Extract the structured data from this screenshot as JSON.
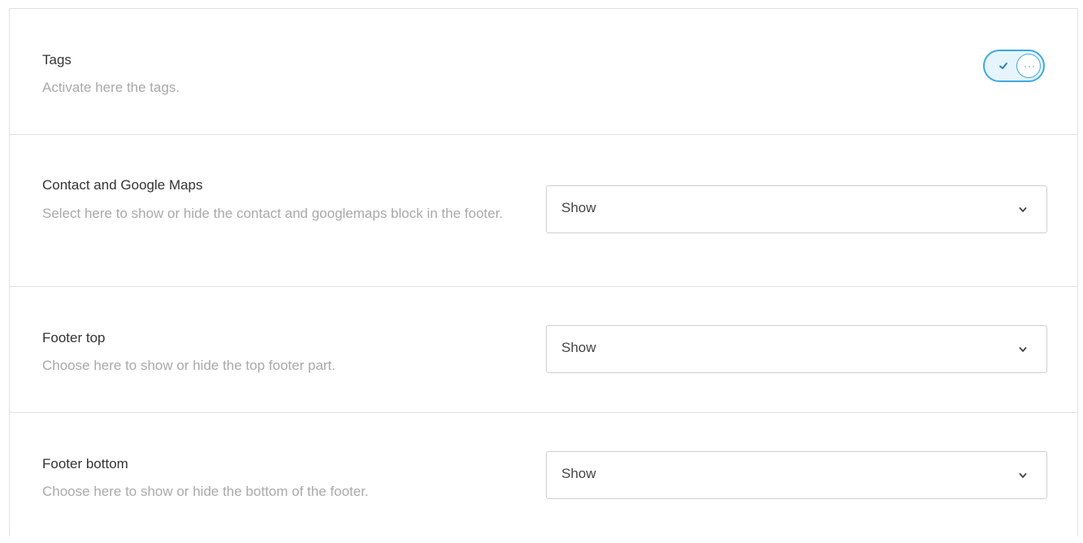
{
  "settings": {
    "tags": {
      "title": "Tags",
      "description": "Activate here the tags.",
      "enabled": true
    },
    "contact_maps": {
      "title": "Contact and Google Maps",
      "description": "Select here to show or hide the contact and googlemaps block in the footer.",
      "value": "Show"
    },
    "footer_top": {
      "title": "Footer top",
      "description": "Choose here to show or hide the top footer part.",
      "value": "Show"
    },
    "footer_bottom": {
      "title": "Footer bottom",
      "description": "Choose here to show or hide the bottom of the footer.",
      "value": "Show"
    }
  },
  "colors": {
    "accent": "#3fa9dd",
    "toggle_bg": "#e6f5fd",
    "title_text": "#333333",
    "description_text": "#a9a9a9",
    "border": "#e1e1e1"
  },
  "icons": {
    "toggle_check": "check-icon",
    "toggle_knob": "ellipsis-icon",
    "select_arrow": "chevron-down-icon"
  }
}
